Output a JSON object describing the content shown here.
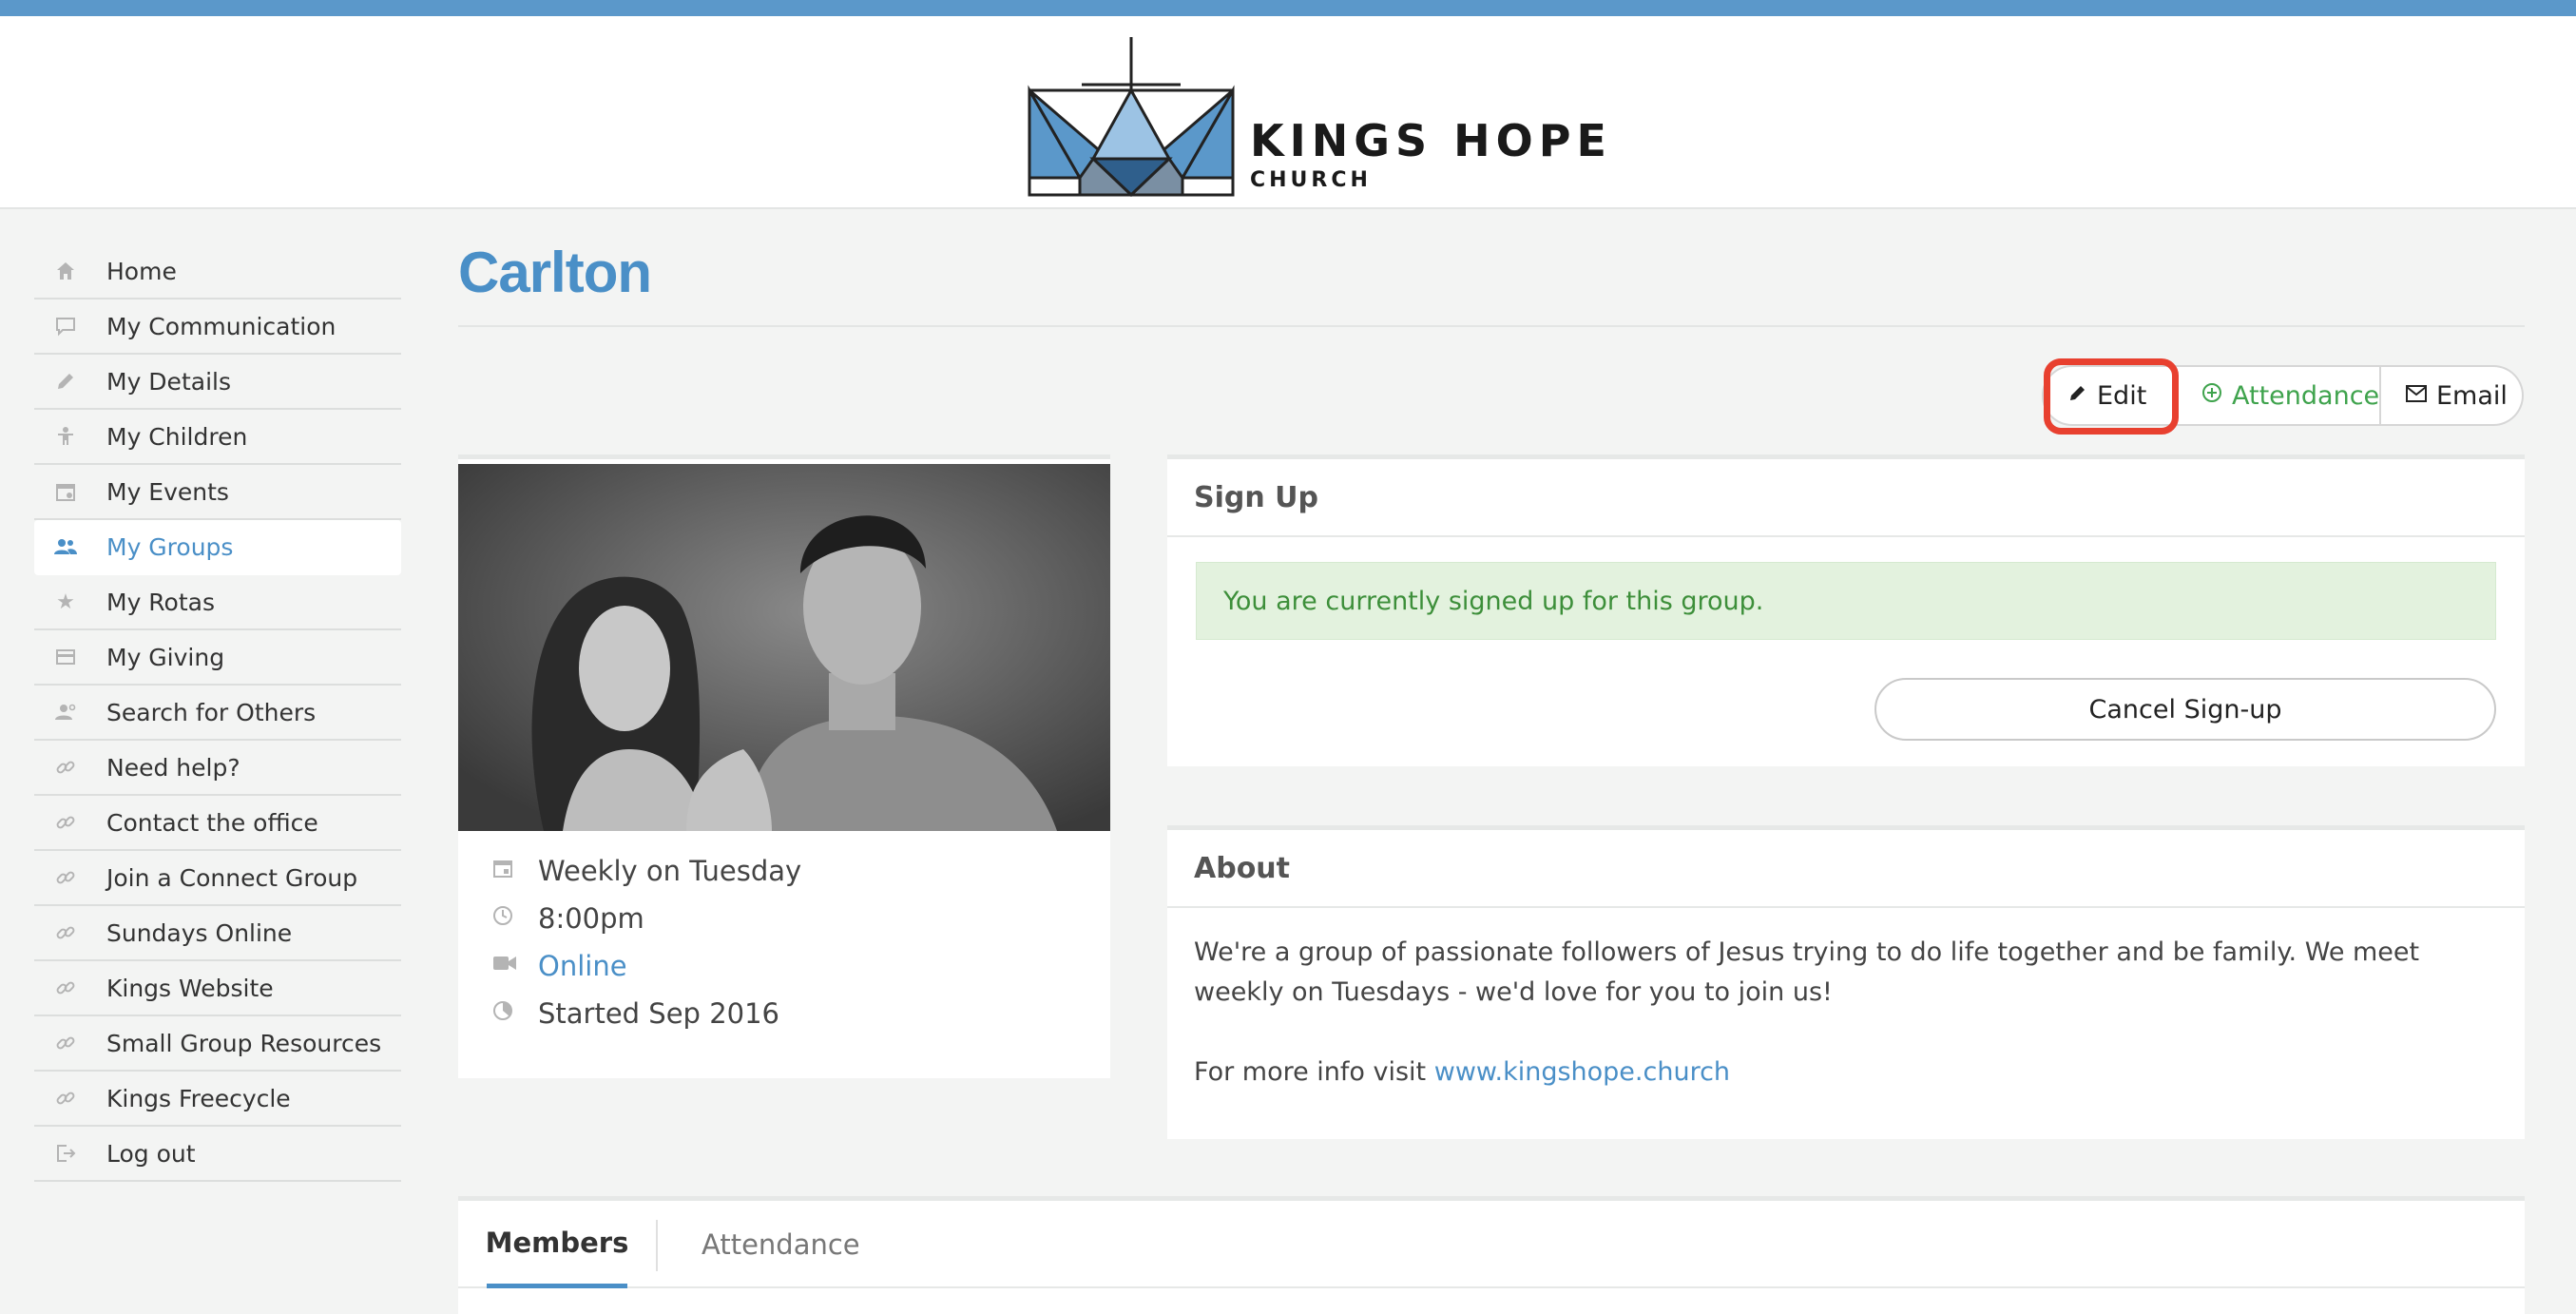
{
  "header": {
    "brand_name": "KINGS HOPE",
    "brand_sub": "CHURCH"
  },
  "sidebar": {
    "items": [
      {
        "label": "Home",
        "icon": "home-icon"
      },
      {
        "label": "My Communication",
        "icon": "chat-icon"
      },
      {
        "label": "My Details",
        "icon": "pencil-icon"
      },
      {
        "label": "My Children",
        "icon": "child-icon"
      },
      {
        "label": "My Events",
        "icon": "calendar-icon"
      },
      {
        "label": "My Groups",
        "icon": "group-icon",
        "active": true
      },
      {
        "label": "My Rotas",
        "icon": "star-icon"
      },
      {
        "label": "My Giving",
        "icon": "card-icon"
      },
      {
        "label": "Search for Others",
        "icon": "people-search-icon"
      },
      {
        "label": "Need help?",
        "icon": "link-icon"
      },
      {
        "label": "Contact the office",
        "icon": "link-icon"
      },
      {
        "label": "Join a Connect Group",
        "icon": "link-icon"
      },
      {
        "label": "Sundays Online",
        "icon": "link-icon"
      },
      {
        "label": "Kings Website",
        "icon": "link-icon"
      },
      {
        "label": "Small Group Resources",
        "icon": "link-icon"
      },
      {
        "label": "Kings Freecycle",
        "icon": "link-icon"
      },
      {
        "label": "Log out",
        "icon": "logout-icon"
      }
    ]
  },
  "page": {
    "title": "Carlton"
  },
  "actions": {
    "edit_label": "Edit",
    "attendance_label": "Attendance",
    "email_label": "Email"
  },
  "group_details": {
    "schedule": "Weekly on Tuesday",
    "time": "8:00pm",
    "location": "Online",
    "started": "Started Sep 2016"
  },
  "signup": {
    "heading": "Sign Up",
    "status_message": "You are currently signed up for this group.",
    "cancel_label": "Cancel Sign-up"
  },
  "about": {
    "heading": "About",
    "paragraph": "We're a group of passionate followers of Jesus trying to do life together and be family. We meet weekly on Tuesdays - we'd love for you to join us!",
    "more_info_prefix": "For more info visit ",
    "more_info_link": "www.kingshope.church"
  },
  "tabs": {
    "members_label": "Members",
    "attendance_label": "Attendance"
  },
  "colors": {
    "accent": "#4a8fc7",
    "success": "#3d8f3a",
    "highlight": "#e8402f",
    "top_bar": "#5b98ca"
  }
}
